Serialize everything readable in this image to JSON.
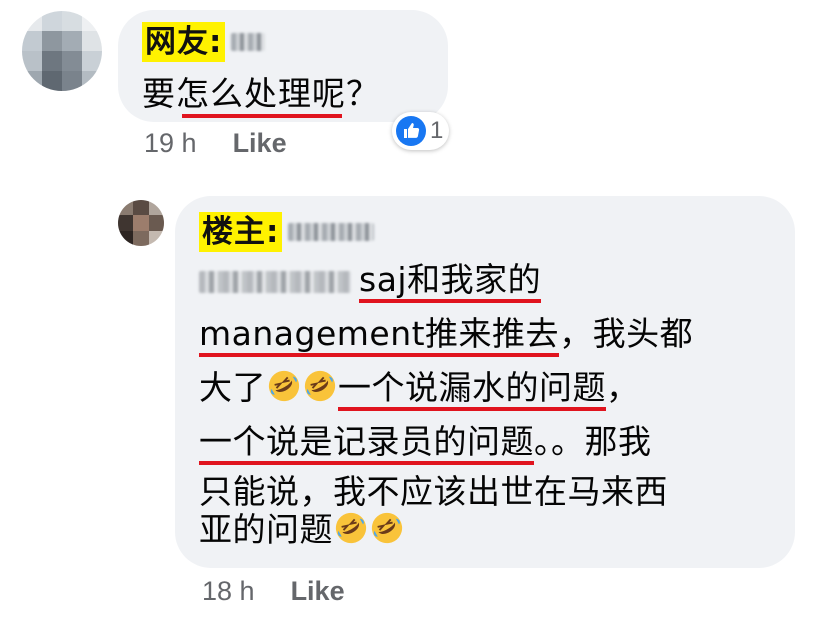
{
  "comment1": {
    "author_tag": "网友:",
    "text": "要怎么处理呢？",
    "time": "19 h",
    "like_label": "Like",
    "reaction_icon": "like-thumb-icon",
    "reaction_count": "1"
  },
  "comment2": {
    "author_tag": "楼主:",
    "line1_text": "saj和我家的",
    "line2_text": "management推来推去",
    "line2_rest": "，我头都",
    "line3_pre": "大了",
    "line3_underlined": "一个说漏水的问题",
    "line3_post": "，",
    "line4_underlined": "一个说是记录员的问题",
    "line4_rest": "。。那我",
    "line5_text": "只能说，我不应该出世在马来西",
    "line6_text": "亚的问题",
    "emoji_icon": "rolling-on-floor-laughing-icon",
    "time": "18 h",
    "like_label": "Like"
  },
  "colors": {
    "bubble": "#f0f2f5",
    "highlight": "#fff200",
    "underline": "#e0141e",
    "meta_text": "#65676b",
    "like_blue": "#1877f2"
  }
}
